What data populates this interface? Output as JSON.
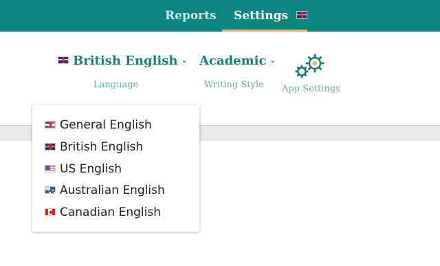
{
  "colors": {
    "topbar": "#0e8580",
    "accent": "#157f7a",
    "caption": "#5fb0ab",
    "tab_underline": "#f2b46a"
  },
  "nav": {
    "tabs": [
      {
        "label": "Reports",
        "active": false
      },
      {
        "label": "Settings",
        "active": true,
        "icon": "uk-flag-icon"
      }
    ]
  },
  "settings": {
    "language": {
      "value": "British English",
      "caption": "Language",
      "icon": "uk-flag-icon"
    },
    "writing_style": {
      "value": "Academic",
      "caption": "Writing Style"
    },
    "app_settings": {
      "caption": "App Settings",
      "icon": "gears-icon"
    }
  },
  "language_menu": {
    "open": true,
    "options": [
      {
        "label": "General English",
        "icon": "generic-flag-icon"
      },
      {
        "label": "British English",
        "icon": "uk-flag-icon"
      },
      {
        "label": "US English",
        "icon": "us-flag-icon"
      },
      {
        "label": "Australian English",
        "icon": "australia-flag-icon"
      },
      {
        "label": "Canadian English",
        "icon": "canada-flag-icon"
      }
    ]
  }
}
